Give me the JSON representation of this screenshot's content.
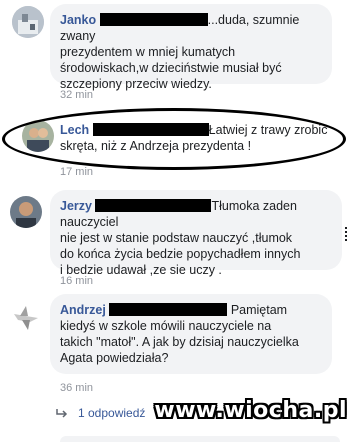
{
  "comments": [
    {
      "author": "Janko",
      "text_after": "...duda, szumnie zwany",
      "lines": [
        "prezydentem w mniej kumatych",
        "środowiskach,w dzieciństwie musiał być",
        "szczepiony przeciw wiedzy."
      ],
      "time": "32 min"
    },
    {
      "author": "Lech",
      "text_after": "Łatwiej z trawy zrobić",
      "lines": [
        "skręta, niż z Andrzeja prezydenta !"
      ],
      "time": "17 min"
    },
    {
      "author": "Jerzy",
      "text_after": "Tłumoka zaden nauczyciel",
      "lines": [
        "nie jest w stanie podstaw nauczyć ,tłumok",
        "do końca życia bedzie popychadłem innych",
        "i bedzie udawał ,ze sie uczy ."
      ],
      "time": "16 min"
    },
    {
      "author": "Andrzej",
      "text_after": "Pamiętam",
      "lines": [
        "kiedyś w szkole mówili nauczyciele na",
        "takich \"matoł\". A jak by dzisiaj nauczycielka",
        "Agata powiedziała?"
      ],
      "time": "36 min"
    }
  ],
  "reply": {
    "label": "1 odpowiedź",
    "icon": "reply-arrow-icon"
  },
  "watermark": "www.wiocha.pl",
  "colors": {
    "bubble": "#f2f3f5",
    "author": "#385898",
    "timestamp": "#90949c",
    "redaction": "#000000"
  }
}
